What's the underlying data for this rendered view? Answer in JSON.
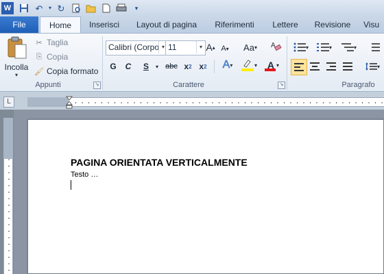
{
  "qat": {
    "icons": [
      "word-logo-icon",
      "save-icon",
      "undo-icon",
      "redo-icon",
      "print-preview-icon",
      "open-icon",
      "new-document-icon",
      "quick-print-icon",
      "customize-qat-icon"
    ]
  },
  "tabs": [
    {
      "label": "File"
    },
    {
      "label": "Home"
    },
    {
      "label": "Inserisci"
    },
    {
      "label": "Layout di pagina"
    },
    {
      "label": "Riferimenti"
    },
    {
      "label": "Lettere"
    },
    {
      "label": "Revisione"
    },
    {
      "label": "Visu"
    }
  ],
  "ribbon": {
    "clipboard": {
      "paste_label": "Incolla",
      "cut_label": "Taglia",
      "copy_label": "Copia",
      "format_painter_label": "Copia formato",
      "group_label": "Appunti"
    },
    "font": {
      "font_name": "Calibri (Corpo",
      "font_size": "11",
      "grow_label": "A",
      "shrink_label": "A",
      "case_label": "Aa",
      "bold": "G",
      "italic": "C",
      "underline": "S",
      "strikethrough": "abc",
      "subscript": "x",
      "superscript": "x",
      "subscript_mark": "2",
      "superscript_mark": "2",
      "text_effects": "A",
      "font_color": "A",
      "group_label": "Carattere",
      "highlight_color": "#ffee00",
      "font_color_value": "#e8141b"
    },
    "paragraph": {
      "group_label": "Paragrafo"
    }
  },
  "document": {
    "title": "PAGINA ORIENTATA VERTICALMENTE",
    "body": "Testo …"
  }
}
